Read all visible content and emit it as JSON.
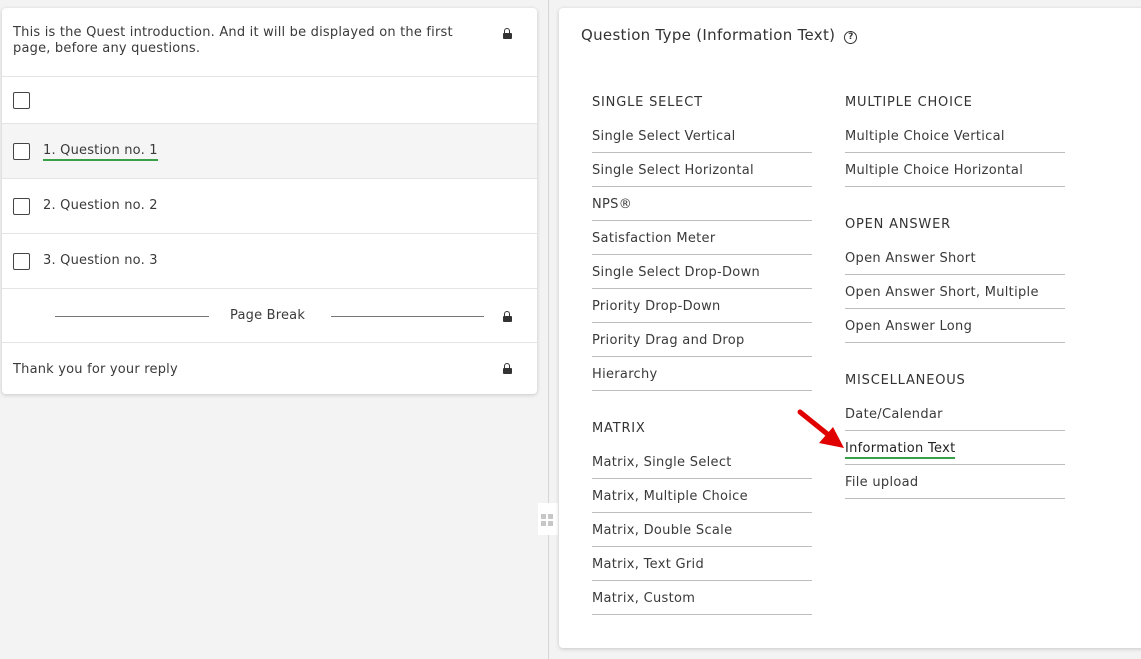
{
  "quest": {
    "intro_text": "This is the Quest introduction. And it will be displayed on the first page, before any questions.",
    "questions": [
      {
        "label": "1.  Question no. 1"
      },
      {
        "label": "2.  Question no. 2"
      },
      {
        "label": "3.  Question no. 3"
      }
    ],
    "page_break_label": "Page Break",
    "thanks_text": "Thank you for your reply"
  },
  "question_type_panel": {
    "title": "Question Type (Information Text)",
    "help_icon": "?",
    "sections": {
      "single_select": {
        "heading": "SINGLE SELECT",
        "items": [
          "Single Select Vertical",
          "Single Select Horizontal",
          "NPS®",
          "Satisfaction Meter",
          "Single Select Drop-Down",
          "Priority Drop-Down",
          "Priority Drag and Drop",
          "Hierarchy"
        ]
      },
      "matrix": {
        "heading": "MATRIX",
        "items": [
          "Matrix, Single Select",
          "Matrix, Multiple Choice",
          "Matrix, Double Scale",
          "Matrix, Text Grid",
          "Matrix, Custom"
        ]
      },
      "multiple_choice": {
        "heading": "MULTIPLE CHOICE",
        "items": [
          "Multiple Choice Vertical",
          "Multiple Choice Horizontal"
        ]
      },
      "open_answer": {
        "heading": "OPEN ANSWER",
        "items": [
          "Open Answer Short",
          "Open Answer Short, Multiple",
          "Open Answer Long"
        ]
      },
      "miscellaneous": {
        "heading": "MISCELLANEOUS",
        "items": [
          "Date/Calendar",
          "Information Text",
          "File upload"
        ]
      }
    },
    "selected_type": "Information Text"
  },
  "colors": {
    "accent_underline": "#39a04a",
    "arrow": "#e00000"
  }
}
